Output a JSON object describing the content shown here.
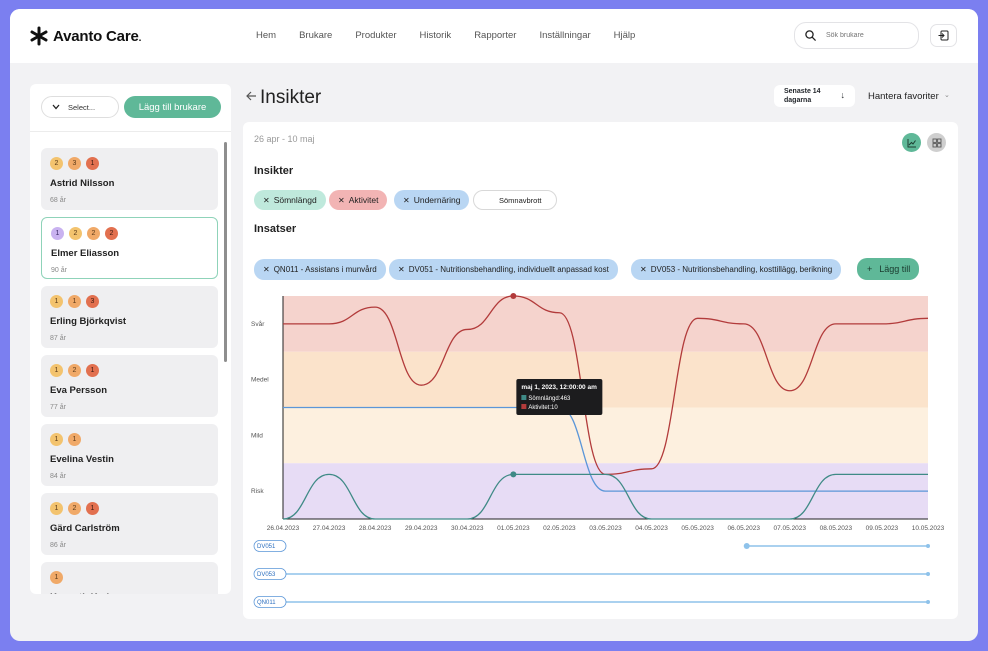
{
  "app": {
    "logo_text": "Avanto Care",
    "logo_dot": "."
  },
  "nav": [
    "Hem",
    "Brukare",
    "Produkter",
    "Historik",
    "Rapporter",
    "Inställningar",
    "Hjälp"
  ],
  "search": {
    "placeholder": "Sök brukare"
  },
  "sidebar": {
    "select_label": "Select...",
    "add_button": "Lägg till brukare",
    "patients": [
      {
        "name": "Astrid Nilsson",
        "age": "68 år",
        "badges": [
          {
            "v": "2",
            "t": "b1"
          },
          {
            "v": "3",
            "t": "b2"
          },
          {
            "v": "1",
            "t": "b3"
          }
        ]
      },
      {
        "name": "Elmer Eliasson",
        "age": "90 år",
        "badges": [
          {
            "v": "1",
            "t": "bp"
          },
          {
            "v": "2",
            "t": "b1"
          },
          {
            "v": "2",
            "t": "b2"
          },
          {
            "v": "2",
            "t": "b3"
          }
        ],
        "selected": true
      },
      {
        "name": "Erling Björkqvist",
        "age": "87 år",
        "badges": [
          {
            "v": "1",
            "t": "b1"
          },
          {
            "v": "1",
            "t": "b2"
          },
          {
            "v": "3",
            "t": "b3"
          }
        ]
      },
      {
        "name": "Eva Persson",
        "age": "77 år",
        "badges": [
          {
            "v": "1",
            "t": "b1"
          },
          {
            "v": "2",
            "t": "b2"
          },
          {
            "v": "1",
            "t": "b3"
          }
        ]
      },
      {
        "name": "Evelina Vestin",
        "age": "84 år",
        "badges": [
          {
            "v": "1",
            "t": "b1"
          },
          {
            "v": "1",
            "t": "b2"
          }
        ]
      },
      {
        "name": "Gärd Carlström",
        "age": "86 år",
        "badges": [
          {
            "v": "1",
            "t": "b1"
          },
          {
            "v": "2",
            "t": "b2"
          },
          {
            "v": "1",
            "t": "b3"
          }
        ]
      },
      {
        "name": "Kenneth Karlsson",
        "age": "",
        "badges": [
          {
            "v": "1",
            "t": "b2"
          }
        ]
      }
    ]
  },
  "page": {
    "title": "Insikter",
    "period_label": "Senaste 14 dagarna",
    "favorites_label": "Hantera favoriter",
    "date_range": "26 apr - 10 maj"
  },
  "insights": {
    "title": "Insikter",
    "chips": [
      {
        "label": "Sömnlängd",
        "style": "c-green",
        "removable": true
      },
      {
        "label": "Aktivitet",
        "style": "c-red",
        "removable": true
      },
      {
        "label": "Undernäring",
        "style": "c-blue",
        "removable": true
      },
      {
        "label": "Sömnavbrott",
        "style": "c-outline",
        "removable": false
      }
    ]
  },
  "interventions": {
    "title": "Insatser",
    "chips": [
      {
        "label": "QN011 - Assistans i munvård"
      },
      {
        "label": "DV051 - Nutritionsbehandling, individuellt anpassad kost"
      },
      {
        "label": "DV053 - Nutritionsbehandling, kosttillägg, berikning"
      }
    ],
    "add_label": "Lägg till"
  },
  "chart_data": {
    "type": "line",
    "x": [
      "26.04.2023",
      "27.04.2023",
      "28.04.2023",
      "29.04.2023",
      "30.04.2023",
      "01.05.2023",
      "02.05.2023",
      "03.05.2023",
      "04.05.2023",
      "05.05.2023",
      "06.05.2023",
      "07.05.2023",
      "08.05.2023",
      "09.05.2023",
      "10.05.2023"
    ],
    "levels": [
      "Svår",
      "Medel",
      "Mild",
      "Risk"
    ],
    "band_colors": {
      "Svår": "#f5d3cd",
      "Medel": "#fbe3cb",
      "Mild": "#fdf0df",
      "Risk": "#e7dcf5"
    },
    "series": [
      {
        "name": "Aktivitet",
        "color": "#b23b3b",
        "values": [
          3.5,
          3.5,
          3.8,
          2.4,
          3.4,
          4.0,
          3.7,
          0.8,
          0.9,
          3.6,
          3.5,
          2.3,
          3.5,
          3.5,
          3.6
        ]
      },
      {
        "name": "Undernäring",
        "color": "#5b96d8",
        "values": [
          2.0,
          2.0,
          2.0,
          2.0,
          2.0,
          2.0,
          2.0,
          0.5,
          0.5,
          0.5,
          0.5,
          0.5,
          0.5,
          0.5,
          0.5
        ]
      },
      {
        "name": "Sömnlängd",
        "color": "#3f8a86",
        "values": [
          0.0,
          0.8,
          0.0,
          0.0,
          0.0,
          0.8,
          0.8,
          0.8,
          0.0,
          0.0,
          0.0,
          0.0,
          0.8,
          0.8,
          0.8
        ]
      }
    ],
    "tooltip": {
      "title": "maj 1, 2023, 12:00:00 am",
      "lines": [
        "Sömnlängd:463",
        "Aktivitet:10"
      ],
      "x_index": 5
    },
    "timelines": [
      {
        "label": "DV051",
        "start_index": 10,
        "end_index": 14
      },
      {
        "label": "DV053",
        "start_index": 0,
        "end_index": 14
      },
      {
        "label": "QN011",
        "start_index": 0,
        "end_index": 14
      }
    ]
  }
}
